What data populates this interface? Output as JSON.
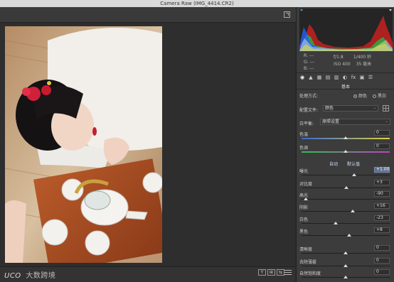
{
  "window": {
    "title": "Camera Raw (IMG_4414.CR2)"
  },
  "watermark": {
    "logo": "UCO",
    "text": "大数跨境"
  },
  "view_buttons": [
    "Y",
    "⊞",
    "⇆",
    "≡"
  ],
  "camera_info": {
    "r": "R:   ---",
    "g": "G:   ---",
    "b": "B:   ---",
    "aperture": "f/1.8",
    "shutter": "1/400 秒",
    "iso": "ISO 400",
    "focal": "35 毫米"
  },
  "tabs": [
    "◉",
    "▲",
    "▦",
    "▤",
    "▥",
    "◐",
    "fx",
    "▣",
    "☰"
  ],
  "section": "基本",
  "process": {
    "label": "处理方式:",
    "option_color": "颜色",
    "option_bw": "黑白"
  },
  "profile": {
    "label": "配置文件:",
    "value": "颜色"
  },
  "white_balance": {
    "label": "白平衡:",
    "value": "原照设置"
  },
  "wb_sliders": [
    {
      "label": "色温",
      "value": "0",
      "position": 0.5
    },
    {
      "label": "色调",
      "value": "0",
      "position": 0.5
    }
  ],
  "tone_actions": {
    "auto": "自动",
    "default": "默认值"
  },
  "tone_sliders": [
    {
      "label": "曝光",
      "value": "+1.00",
      "active": true,
      "position": 0.6
    },
    {
      "label": "对比度",
      "value": "+3",
      "active": false,
      "position": 0.51
    },
    {
      "label": "高光",
      "value": "-90",
      "active": false,
      "position": 0.05
    },
    {
      "label": "阴影",
      "value": "+16",
      "active": false,
      "position": 0.58
    },
    {
      "label": "白色",
      "value": "-23",
      "active": false,
      "position": 0.39
    },
    {
      "label": "黑色",
      "value": "+8",
      "active": false,
      "position": 0.54
    }
  ],
  "presence_sliders": [
    {
      "label": "清晰度",
      "value": "0",
      "position": 0.5
    },
    {
      "label": "去除薄雾",
      "value": "0",
      "position": 0.5
    },
    {
      "label": "自然饱和度",
      "value": "0",
      "position": 0.5
    }
  ],
  "colors": {
    "accent": "#5a6e8c",
    "panel": "#3c3c3c",
    "canvas": "#2e2e2e"
  }
}
